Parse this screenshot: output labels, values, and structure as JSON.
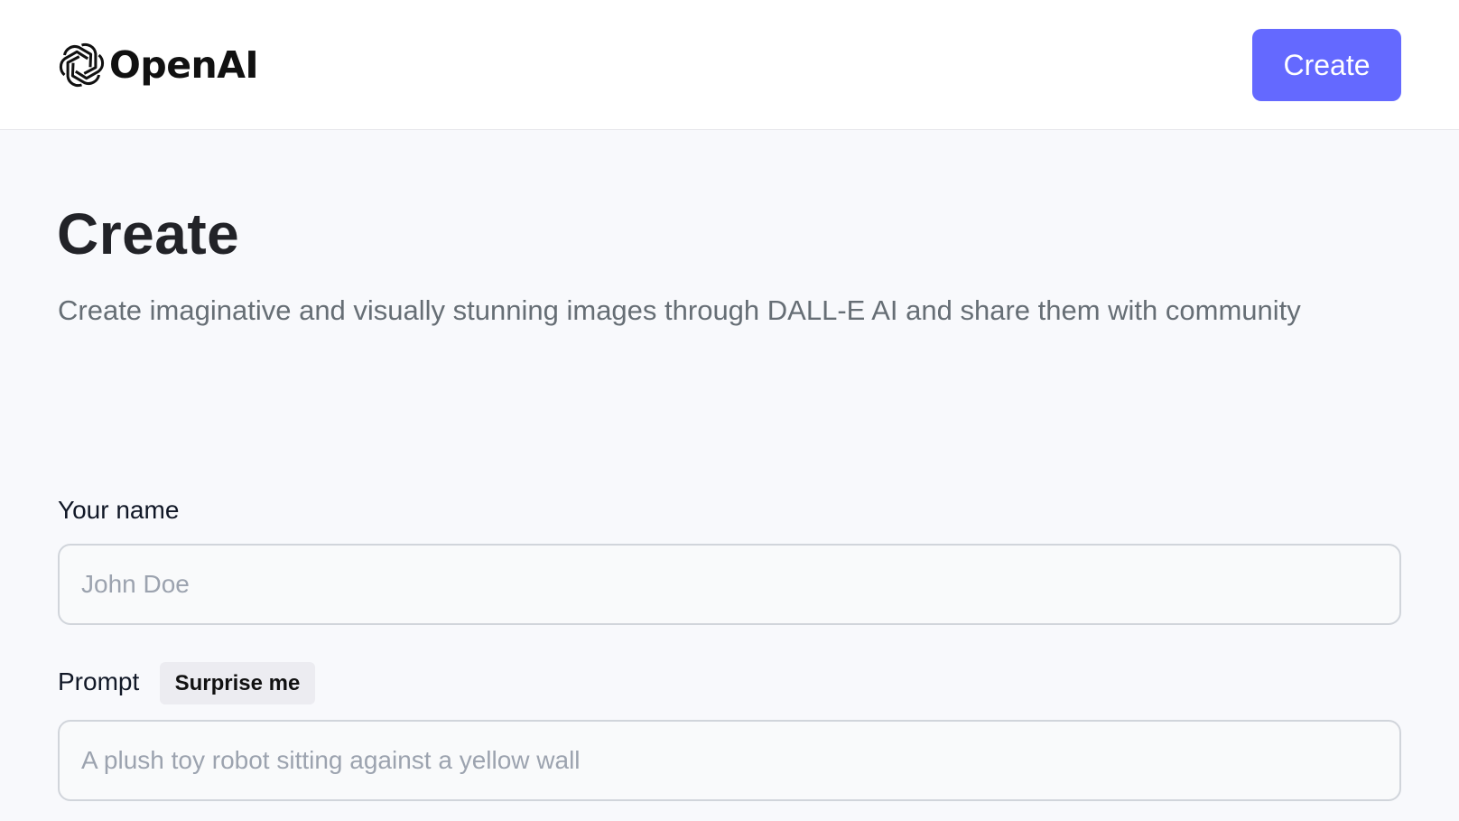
{
  "header": {
    "logo_text": "OpenAI",
    "logo_icon": "openai-logo-icon",
    "create_label": "Create",
    "accent_color": "#6469ff"
  },
  "main": {
    "title": "Create",
    "subtitle": "Create imaginative and visually stunning images through DALL-E AI and share them with community"
  },
  "form": {
    "name_label": "Your name",
    "name_placeholder": "John Doe",
    "name_value": "",
    "prompt_label": "Prompt",
    "surprise_label": "Surprise me",
    "prompt_placeholder": "A plush toy robot sitting against a yellow wall",
    "prompt_value": ""
  }
}
